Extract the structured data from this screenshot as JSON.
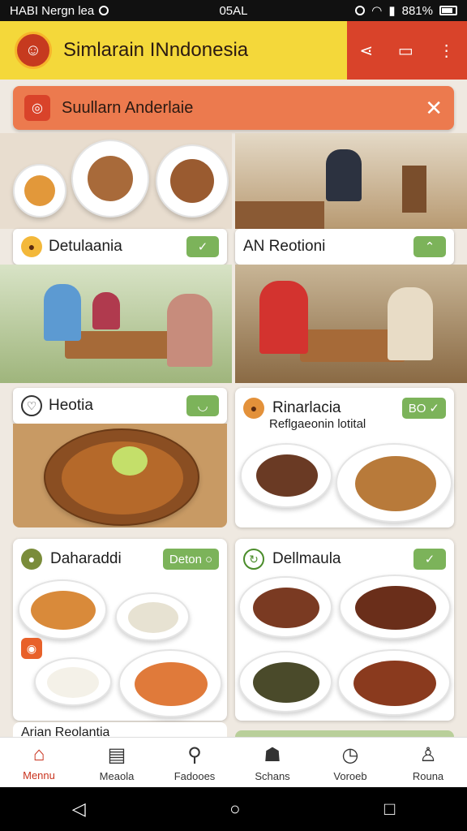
{
  "status_bar": {
    "left_text": "HABI Nergn lea",
    "time": "05AL",
    "battery": "881%"
  },
  "app_bar": {
    "title": "Simlarain INndonesia"
  },
  "banner": {
    "text": "Suullarn Anderlaie"
  },
  "tiles": [
    {
      "name": "Detulaania"
    },
    {
      "name": "AN Reotioni"
    },
    {
      "name": "Heotia"
    }
  ],
  "cards": [
    {
      "name": "Rinarlacia",
      "subtitle": "Reflgaeonin lotital",
      "badge": "BO"
    },
    {
      "name": "Daharaddi",
      "badge": "Deton"
    },
    {
      "name": "Dellmaula"
    }
  ],
  "partial_card": {
    "name": "Arian Reolantia"
  },
  "bottom_nav": [
    {
      "label": "Mennu"
    },
    {
      "label": "Meaola"
    },
    {
      "label": "Fadooes"
    },
    {
      "label": "Schans"
    },
    {
      "label": "Voroeb"
    },
    {
      "label": "Rouna"
    }
  ],
  "colors": {
    "brand_yellow": "#f4d83a",
    "brand_red": "#d9432a",
    "accent_green": "#7cb35a",
    "banner_orange": "#ec7a4e"
  }
}
